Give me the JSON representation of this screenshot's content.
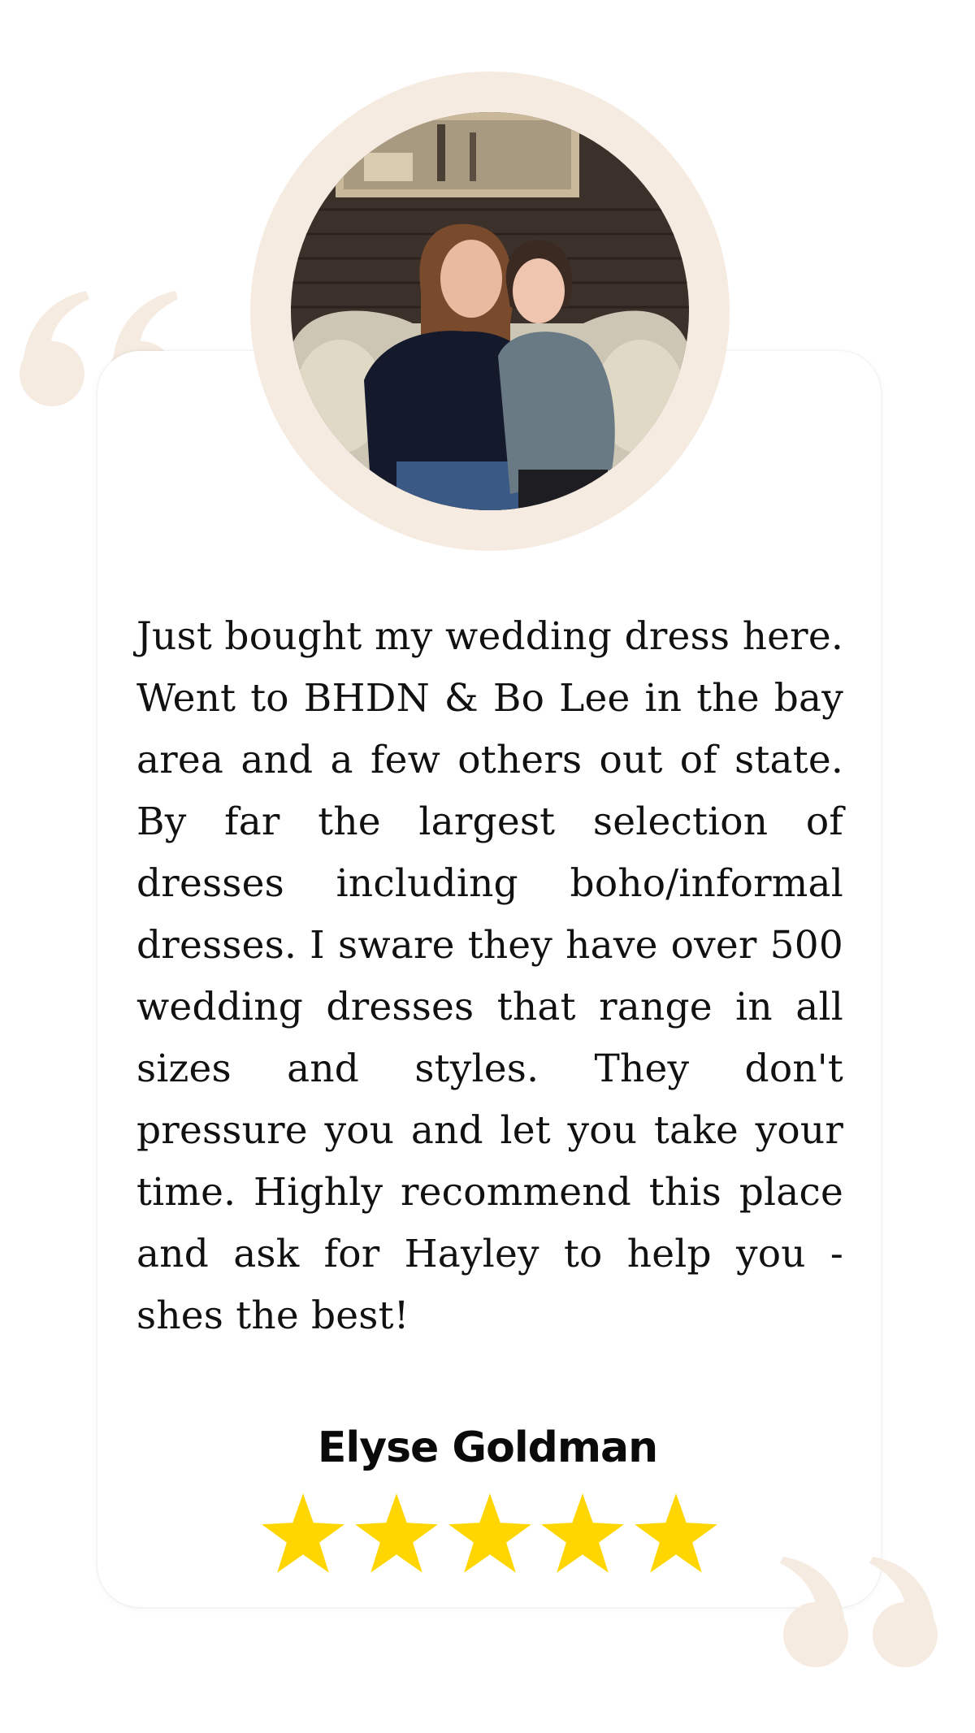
{
  "testimonial": {
    "review_text": "Just bought my wedding dress here. Went to BHDN & Bo Lee in the bay area and a few others out of state. By far the largest selection of dresses including boho/informal dresses. I sware they have over 500 wedding dresses that range in all sizes and styles. They don't pressure you and let you take your time. Highly recommend this place and ask for Hayley to help you - shes the best!",
    "reviewer_name": "Elyse Goldman",
    "rating": 5,
    "rating_max": 5
  },
  "icons": {
    "open_quote": "open-quote-icon",
    "close_quote": "close-quote-icon",
    "star": "star-icon"
  },
  "colors": {
    "quote_mark": "#f6ebe1",
    "avatar_ring": "#f6ebe1",
    "star": "#ffd600",
    "text": "#111111"
  }
}
